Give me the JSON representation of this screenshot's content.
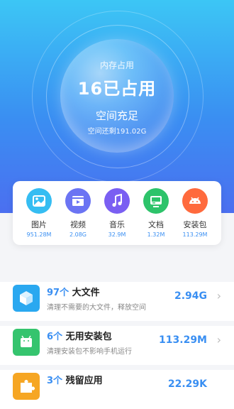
{
  "memory": {
    "label": "内存占用",
    "used": "16已占用",
    "status": "空间充足",
    "remaining": "空间还剩191.02G"
  },
  "categories": [
    {
      "name": "图片",
      "size": "951.28M",
      "icon": "image-icon",
      "color": "#35bdf2"
    },
    {
      "name": "视频",
      "size": "2.08G",
      "icon": "video-icon",
      "color": "#6b74f3"
    },
    {
      "name": "音乐",
      "size": "32.9M",
      "icon": "music-icon",
      "color": "#7a5ff2"
    },
    {
      "name": "文档",
      "size": "1.32M",
      "icon": "document-icon",
      "color": "#2dc36a"
    },
    {
      "name": "安装包",
      "size": "113.29M",
      "icon": "android-icon",
      "color": "#ff6a3d"
    }
  ],
  "cleanup": [
    {
      "count": "97个",
      "title": "大文件",
      "desc": "清理不需要的大文件，释放空间",
      "amount": "2.94G",
      "icon": "cube-icon",
      "color": "#2aa8f0"
    },
    {
      "count": "6个",
      "title": "无用安装包",
      "desc": "清理安装包不影响手机运行",
      "amount": "113.29M",
      "icon": "android-icon",
      "color": "#35c46e"
    },
    {
      "count": "3个",
      "title": "残留应用",
      "desc": "",
      "amount": "22.29K",
      "icon": "puzzle-icon",
      "color": "#f6a623"
    }
  ]
}
